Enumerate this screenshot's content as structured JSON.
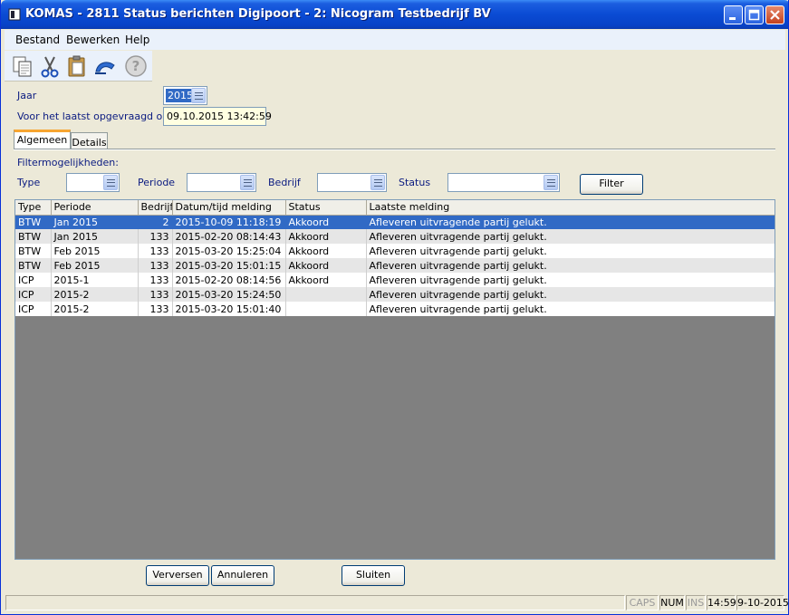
{
  "window": {
    "title": "KOMAS - 2811 Status berichten Digipoort - 2: Nicogram Testbedrijf BV"
  },
  "menu": {
    "items": [
      "Bestand",
      "Bewerken",
      "Help"
    ]
  },
  "toolbar": {
    "icons": [
      "copy-icon",
      "cut-icon",
      "paste-icon",
      "undo-icon",
      "help-icon"
    ]
  },
  "form": {
    "jaar_label": "Jaar",
    "jaar_value": "2015",
    "laatst_label": "Voor het laatst opgevraagd op",
    "laatst_value": "09.10.2015 13:42:59"
  },
  "tabs": [
    "Algemeen",
    "Details"
  ],
  "filter": {
    "heading": "Filtermogelijkheden:",
    "type_label": "Type",
    "periode_label": "Periode",
    "bedrijf_label": "Bedrijf",
    "status_label": "Status",
    "button_label": "Filter"
  },
  "grid": {
    "columns": [
      "Type",
      "Periode",
      "Bedrijf",
      "Datum/tijd melding",
      "Status",
      "Laatste melding"
    ],
    "rows": [
      [
        "BTW",
        "Jan 2015",
        "2",
        "2015-10-09 11:18:19",
        "Akkoord",
        "Afleveren uitvragende partij gelukt."
      ],
      [
        "BTW",
        "Jan 2015",
        "133",
        "2015-02-20 08:14:43",
        "Akkoord",
        "Afleveren uitvragende partij gelukt."
      ],
      [
        "BTW",
        "Feb 2015",
        "133",
        "2015-03-20 15:25:04",
        "Akkoord",
        "Afleveren uitvragende partij gelukt."
      ],
      [
        "BTW",
        "Feb 2015",
        "133",
        "2015-03-20 15:01:15",
        "Akkoord",
        "Afleveren uitvragende partij gelukt."
      ],
      [
        "ICP",
        "2015-1",
        "133",
        "2015-02-20 08:14:56",
        "Akkoord",
        "Afleveren uitvragende partij gelukt."
      ],
      [
        "ICP",
        "2015-2",
        "133",
        "2015-03-20 15:24:50",
        "",
        "Afleveren uitvragende partij gelukt."
      ],
      [
        "ICP",
        "2015-2",
        "133",
        "2015-03-20 15:01:40",
        "",
        "Afleveren uitvragende partij gelukt."
      ]
    ],
    "selected_row": 0
  },
  "buttons": {
    "verversen": "Verversen",
    "annuleren": "Annuleren",
    "sluiten": "Sluiten"
  },
  "statusbar": {
    "caps": "CAPS",
    "num": "NUM",
    "ins": "INS",
    "time": "14:59",
    "date": "9-10-2015"
  },
  "colors": {
    "titlebar": "#0A4BD4",
    "selection": "#316AC5",
    "label_text": "#0A1A80",
    "window_bg": "#ECE9D8",
    "tab_accent": "#F7A531"
  }
}
